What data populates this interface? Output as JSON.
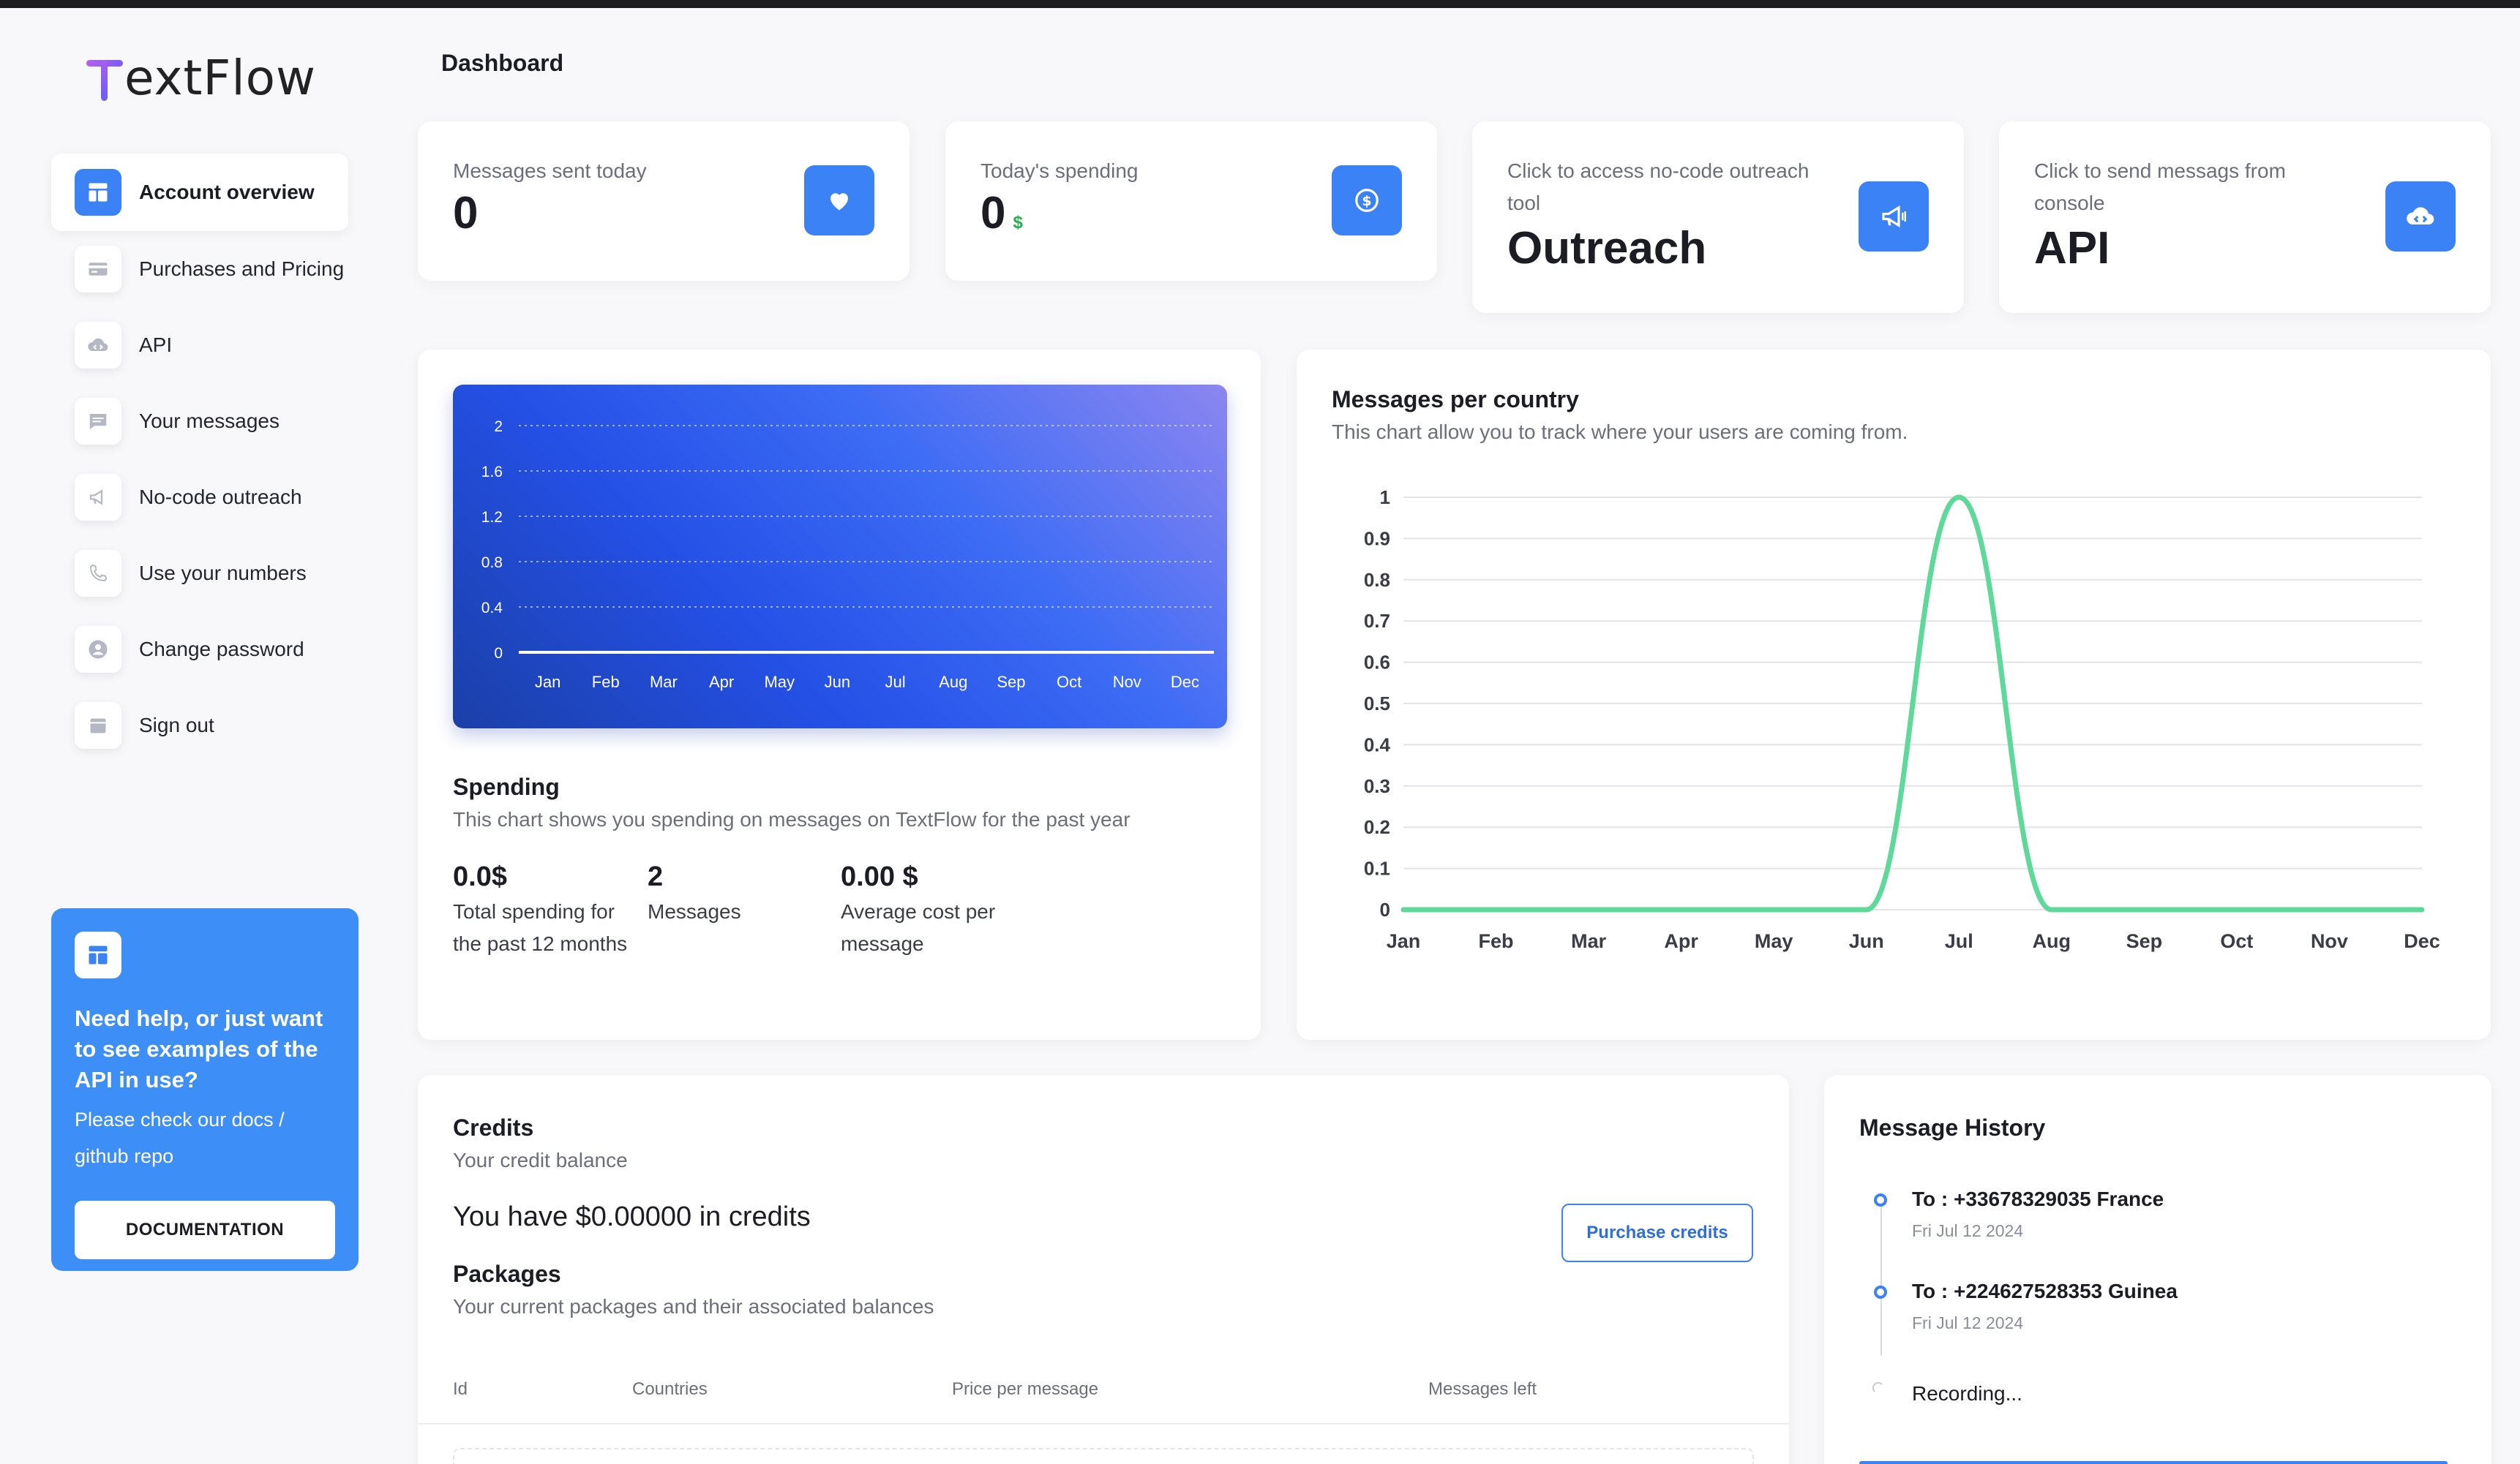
{
  "app": {
    "logo_first": "T",
    "logo_rest": "extFlow"
  },
  "header": {
    "title": "Dashboard"
  },
  "sidebar": {
    "items": [
      {
        "label": "Account overview",
        "icon": "dashboard-icon",
        "active": true
      },
      {
        "label": "Purchases and Pricing",
        "icon": "credit-card-icon"
      },
      {
        "label": "API",
        "icon": "cloud-icon"
      },
      {
        "label": "Your messages",
        "icon": "message-icon"
      },
      {
        "label": "No-code outreach",
        "icon": "megaphone-icon"
      },
      {
        "label": "Use your numbers",
        "icon": "phone-icon"
      },
      {
        "label": "Change password",
        "icon": "user-icon"
      },
      {
        "label": "Sign out",
        "icon": "calendar-icon"
      }
    ]
  },
  "help": {
    "title": "Need help, or just want to see examples of the API in use?",
    "subtitle": "Please check our docs / github repo",
    "button": "DOCUMENTATION"
  },
  "stats": {
    "messages_today": {
      "label": "Messages sent today",
      "value": "0"
    },
    "spending": {
      "label": "Today's spending",
      "value": "0",
      "currency": "$"
    },
    "outreach": {
      "label": "Click to access no-code outreach tool",
      "value": "Outreach"
    },
    "api": {
      "label": "Click to send messags from console",
      "value": "API"
    }
  },
  "spending_card": {
    "title": "Spending",
    "subtitle": "This chart shows you spending on messages on TextFlow for the past year",
    "total_value": "0.0$",
    "total_label": "Total spending for the past 12 months",
    "messages_value": "2",
    "messages_label": "Messages",
    "avg_value": "0.00 $",
    "avg_label": "Average cost per message"
  },
  "country_card": {
    "title": "Messages per country",
    "subtitle": "This chart allow you to track where your users are coming from."
  },
  "chart_data": [
    {
      "type": "line",
      "x": [
        "Jan",
        "Feb",
        "Mar",
        "Apr",
        "May",
        "Jun",
        "Jul",
        "Aug",
        "Sep",
        "Oct",
        "Nov",
        "Dec"
      ],
      "series": [
        {
          "values": [
            0,
            0,
            0,
            0,
            0,
            0,
            0,
            0,
            0,
            0,
            0,
            0
          ]
        }
      ],
      "yticks": [
        "2",
        "1.6",
        "1.2",
        "0.8",
        "0.4",
        "0"
      ],
      "ylim": [
        0,
        2
      ],
      "grid": true,
      "colors": {
        "line": "#ffffff",
        "background": "#2450e6"
      }
    },
    {
      "type": "line",
      "x": [
        "Jan",
        "Feb",
        "Mar",
        "Apr",
        "May",
        "Jun",
        "Jul",
        "Aug",
        "Sep",
        "Oct",
        "Nov",
        "Dec"
      ],
      "series": [
        {
          "values": [
            0,
            0,
            0,
            0,
            0,
            0,
            1,
            0,
            0,
            0,
            0,
            0
          ]
        }
      ],
      "yticks": [
        "1",
        "0.9",
        "0.8",
        "0.7",
        "0.6",
        "0.5",
        "0.4",
        "0.3",
        "0.2",
        "0.1",
        "0"
      ],
      "ylim": [
        0,
        1
      ],
      "grid": true,
      "colors": {
        "line": "#5fd99a"
      }
    }
  ],
  "credits": {
    "title": "Credits",
    "subtitle": "Your credit balance",
    "balance_text": "You have $0.00000 in credits",
    "purchase_button": "Purchase credits",
    "packages_title": "Packages",
    "packages_subtitle": "Your current packages and their associated balances",
    "columns": [
      "Id",
      "Countries",
      "Price per message",
      "Messages left"
    ]
  },
  "history": {
    "title": "Message History",
    "items": [
      {
        "to": "To : +33678329035 France",
        "date": "Fri Jul 12 2024"
      },
      {
        "to": "To : +224627528353 Guinea",
        "date": "Fri Jul 12 2024"
      }
    ],
    "recording": "Recording..."
  }
}
